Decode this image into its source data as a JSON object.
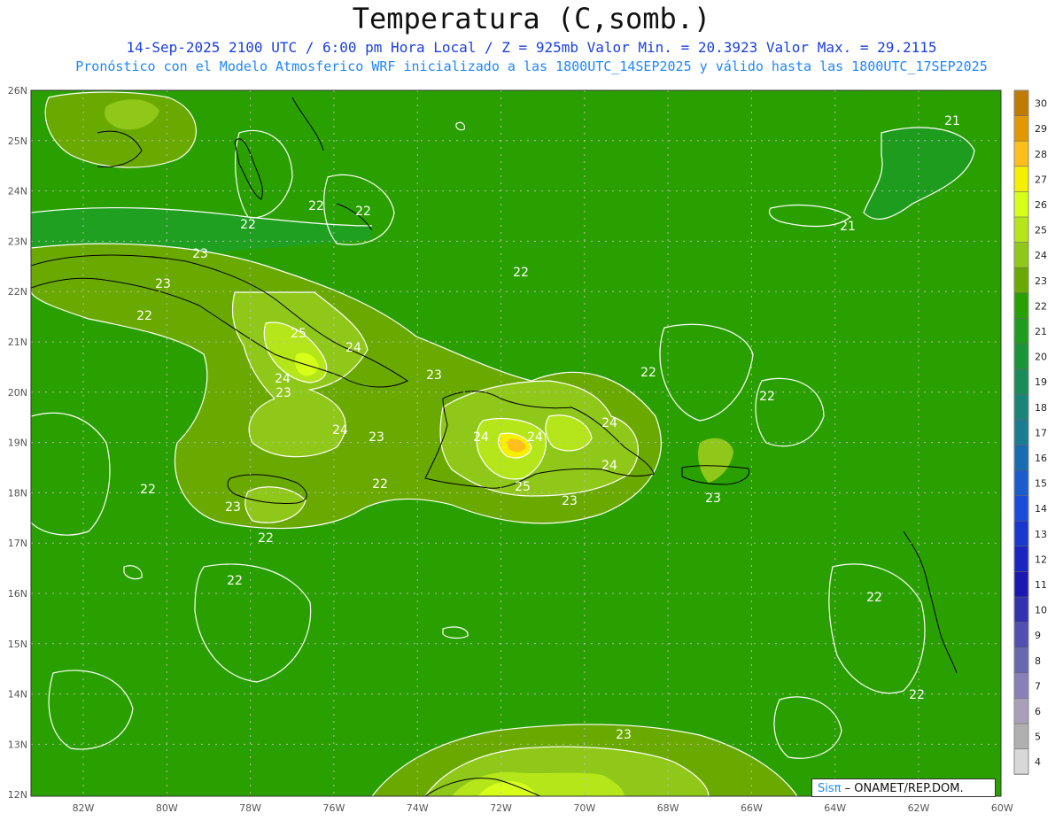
{
  "header": {
    "title": "Temperatura (C,somb.)",
    "line1": "14-Sep-2025  2100 UTC / 6:00 pm Hora Local / Z = 925mb    Valor Min. = 20.3923  Valor Max. = 29.2115",
    "line2": "Pronóstico con el Modelo Atmosferico WRF inicializado a las 1800UTC_14SEP2025 y válido hasta las  1800UTC_17SEP2025"
  },
  "axes": {
    "lon_ticks": [
      "82W",
      "80W",
      "78W",
      "76W",
      "74W",
      "72W",
      "70W",
      "68W",
      "66W",
      "64W",
      "62W",
      "60W"
    ],
    "lat_ticks": [
      "26N",
      "25N",
      "24N",
      "23N",
      "22N",
      "21N",
      "20N",
      "19N",
      "18N",
      "17N",
      "16N",
      "15N",
      "14N",
      "13N",
      "12N"
    ]
  },
  "colorbar": {
    "labels": [
      "30",
      "29",
      "28",
      "27",
      "26",
      "25",
      "24",
      "23",
      "22",
      "21",
      "20",
      "19",
      "18",
      "17",
      "16",
      "15",
      "14",
      "13",
      "12",
      "11",
      "10",
      "9",
      "8",
      "7",
      "6",
      "5",
      "4"
    ],
    "colors": [
      "#c07c00",
      "#e09a00",
      "#ffbe1a",
      "#f4f000",
      "#d6ff1a",
      "#b4e61a",
      "#90c81a",
      "#6aaa00",
      "#2aa000",
      "#1e9c1e",
      "#1a9438",
      "#1a8c5a",
      "#1a8478",
      "#1a7c90",
      "#1a6cb0",
      "#1a5ccc",
      "#1a4cdc",
      "#1a38d0",
      "#1a24c0",
      "#1a18b0",
      "#3232b0",
      "#5050b0",
      "#6868b0",
      "#8880b8",
      "#a8a0b8",
      "#b0b0b0",
      "#d8d8d8"
    ]
  },
  "contour_labels": [
    "21",
    "21",
    "22",
    "22",
    "22",
    "22",
    "22",
    "22",
    "22",
    "22",
    "22",
    "22",
    "22",
    "22",
    "22",
    "23",
    "23",
    "23",
    "23",
    "23",
    "23",
    "23",
    "23",
    "23",
    "24",
    "24",
    "24",
    "24",
    "24",
    "24",
    "24",
    "25",
    "25"
  ],
  "credit": {
    "brand": "Sisπ",
    "text": " – ONAMET/REP.DOM."
  }
}
